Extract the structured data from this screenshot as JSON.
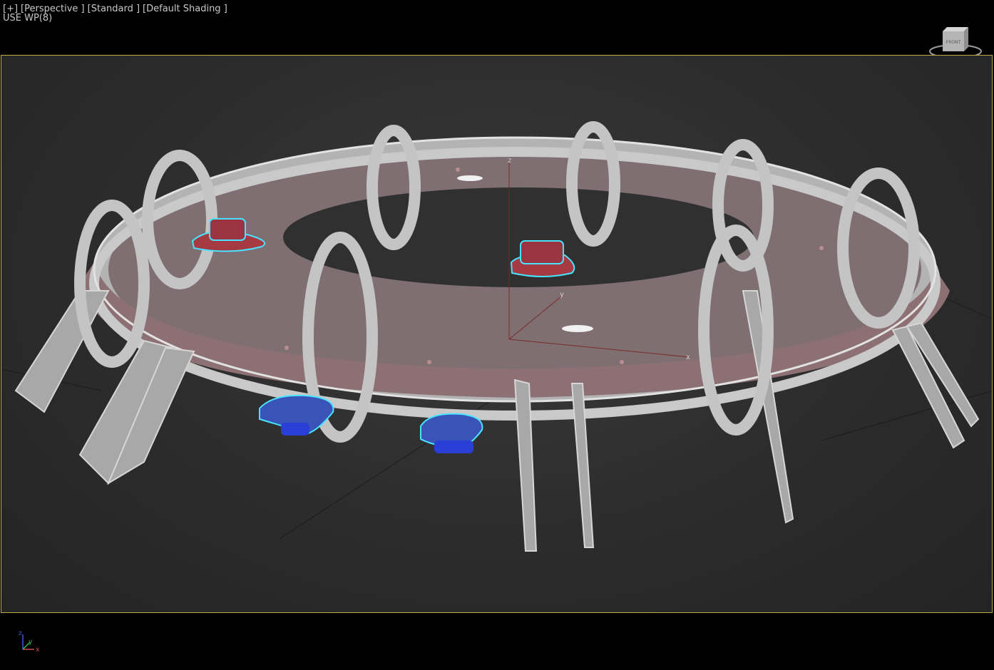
{
  "viewport": {
    "menu_plus": "[+]",
    "view_label": "[Perspective ]",
    "standard_label": "[Standard ]",
    "shading_label": "[Default Shading ]",
    "workplane_label": "USE WP(8)"
  },
  "viewcube": {
    "face_label": "FRONT"
  },
  "gizmo": {
    "x_label": "x",
    "y_label": "y",
    "z_label": "z"
  },
  "axis_tripod": {
    "x_label": "x",
    "y_label": "y",
    "z_label": "z"
  },
  "colors": {
    "frame": "#bda84a",
    "selection": "#48e4ff",
    "red_part": "#a53a43",
    "blue_part": "#2a3fd6",
    "metal": "#bcbcbc"
  }
}
